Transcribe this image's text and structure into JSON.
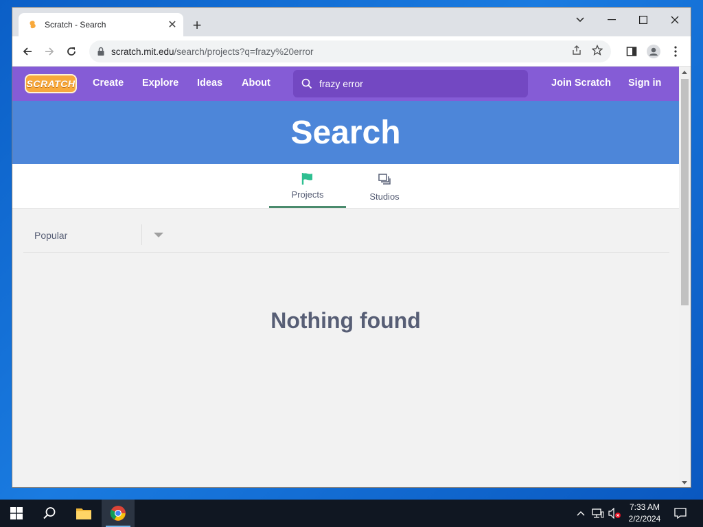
{
  "browser": {
    "tab_title": "Scratch - Search",
    "new_tab": "+",
    "url_host": "scratch.mit.edu",
    "url_path": "/search/projects?q=frazy%20error"
  },
  "scratch": {
    "logo_text": "SCRATCH",
    "nav": {
      "create": "Create",
      "explore": "Explore",
      "ideas": "Ideas",
      "about": "About",
      "join": "Join Scratch",
      "signin": "Sign in"
    },
    "search_value": "frazy error",
    "banner_title": "Search",
    "tabs": [
      {
        "label": "Projects",
        "active": true
      },
      {
        "label": "Studios",
        "active": false
      }
    ],
    "sort_label": "Popular",
    "empty_message": "Nothing found"
  },
  "taskbar": {
    "time": "7:33 AM",
    "date": "2/2/2024"
  },
  "colors": {
    "scratch_purple": "#855cd6",
    "banner_blue": "#4d86d9",
    "active_tab_underline": "#4a8b6d"
  }
}
